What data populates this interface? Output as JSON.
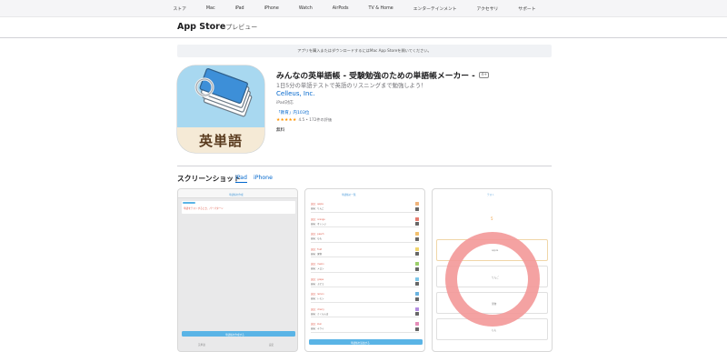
{
  "nav": {
    "items": [
      "ストア",
      "Mac",
      "iPad",
      "iPhone",
      "Watch",
      "AirPods",
      "TV & Home",
      "エンターテインメント",
      "アクセサリ",
      "サポート"
    ]
  },
  "subnav": {
    "title": "App Store",
    "suffix": "プレビュー"
  },
  "banner": {
    "text": "アプリを購入またはダウンロードするにはMac App Storeを開いてください。"
  },
  "app": {
    "icon_text": "英単語",
    "name": "みんなの英単語帳 - 受験勉強のための単語帳メーカー -",
    "age": "4+",
    "subtitle": "1日5分の単語テストで英語のリスニングまで勉強しよう！",
    "developer": "Celleus, Inc.",
    "device": "iPad対応",
    "rank": "「教育」内103位",
    "stars": "★★★★★",
    "rating_text": "4.5 • 172件の評価",
    "price": "無料"
  },
  "screenshots": {
    "heading": "スクリーンショット",
    "tab_ipad": "iPad",
    "tab_iphone": "iPhone"
  },
  "shot1": {
    "title": "単語帳を作成",
    "input_text": "単語をテストするとき、パーパターン",
    "button": "単語帳を作成する",
    "bottom_left": "英単語",
    "bottom_right": "設定"
  },
  "shot2": {
    "title": "単語帳の一覧",
    "rows": [
      {
        "w": "英語：apple",
        "m": "意味：りんご"
      },
      {
        "w": "英語：orange",
        "m": "意味：オレンジ"
      },
      {
        "w": "英語：peach",
        "m": "意味：もも"
      },
      {
        "w": "英語：fruit",
        "m": "意味：果物"
      },
      {
        "w": "英語：melon",
        "m": "意味：メロン"
      },
      {
        "w": "英語：grape",
        "m": "意味：ぶどう"
      },
      {
        "w": "英語：lemon",
        "m": "意味：レモン"
      },
      {
        "w": "英語：cherry",
        "m": "意味：さくらんぼ"
      },
      {
        "w": "英語：kiwi",
        "m": "意味：キウイ"
      }
    ],
    "square_colors": [
      "#f0b37a",
      "#e57c6f",
      "#f3c06d",
      "#f0d46d",
      "#9ccf6a",
      "#7dc6e8",
      "#6ab3e0",
      "#b38de0",
      "#e58cb8"
    ],
    "button": "単語帳を追加する"
  },
  "shot3": {
    "title": "テスト",
    "timer": "5",
    "cards": [
      "apple",
      "りんご",
      "果物",
      "もも"
    ]
  }
}
